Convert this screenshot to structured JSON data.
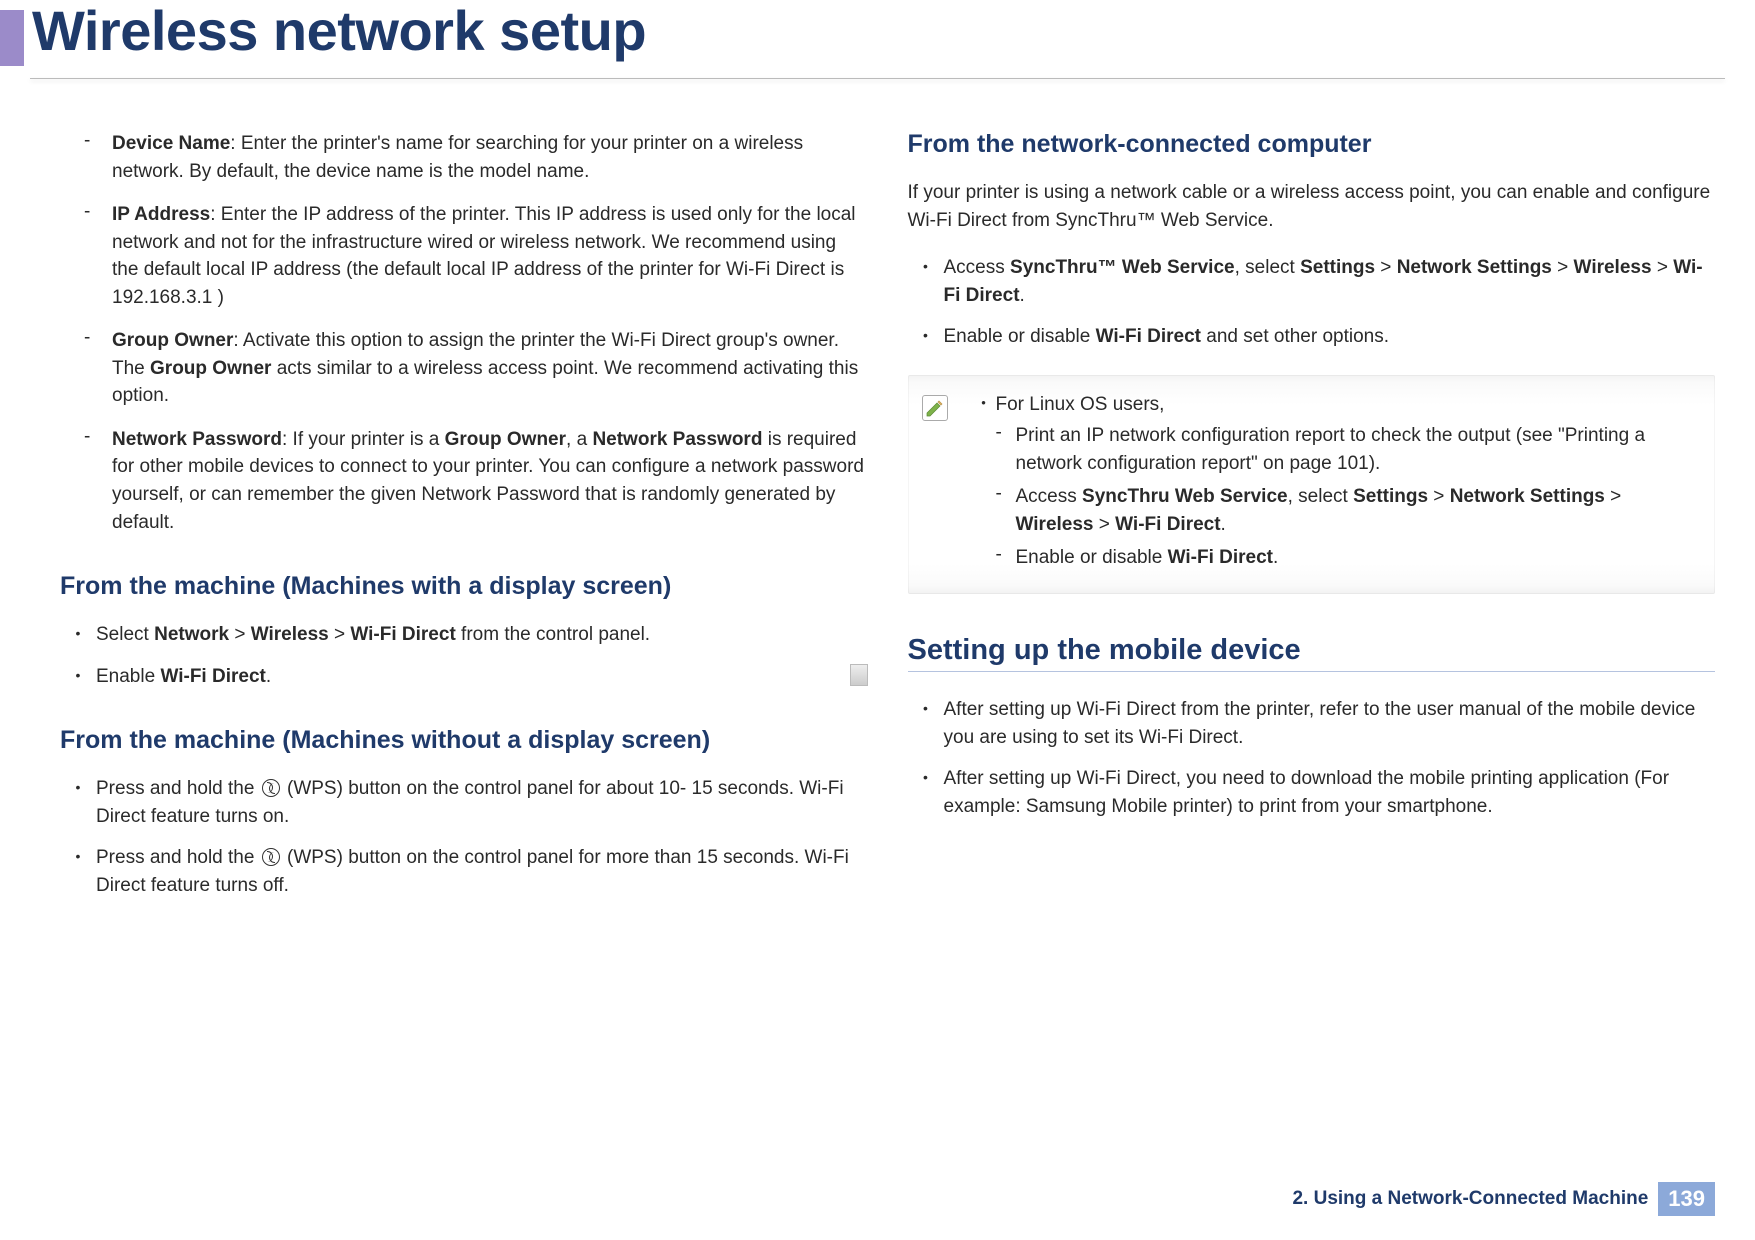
{
  "header": {
    "title": "Wireless network setup"
  },
  "col1": {
    "dash": {
      "device_name_label": "Device Name",
      "device_name_text": ": Enter the printer's name for searching for your printer on a wireless network. By default, the device name is the model name.",
      "ip_label": "IP Address",
      "ip_text": ": Enter the IP address of the printer. This IP address is used only for the local network and not for the infrastructure wired or wireless network. We recommend using the default local IP address (the default local IP address of the printer for Wi-Fi Direct is 192.168.3.1 )",
      "group_owner_label": "Group Owner",
      "group_owner_text_a": ": Activate this option to assign the printer the Wi-Fi Direct group's owner. The ",
      "group_owner_bold_mid": "Group Owner",
      "group_owner_text_b": " acts similar to a wireless access point. We recommend activating this option.",
      "np_label": "Network Password",
      "np_text_a": ": If your printer is a ",
      "np_bold1": "Group Owner",
      "np_text_b": ", a ",
      "np_bold2": "Network Password",
      "np_text_c": " is required for other mobile devices to connect to your printer. You can configure a network password yourself, or can remember the given Network Password that is randomly generated by default."
    },
    "sec_display": {
      "title": "From the machine (Machines with a display screen)",
      "b1_a": "Select ",
      "b1_net": "Network",
      "b1_gt1": " > ",
      "b1_wl": "Wireless",
      "b1_gt2": " > ",
      "b1_wfd": "Wi-Fi Direct",
      "b1_b": " from the control panel.",
      "b2_a": "Enable ",
      "b2_wfd": "Wi-Fi Direct",
      "b2_b": "."
    },
    "sec_nodisplay": {
      "title": "From the machine (Machines without a display screen)",
      "b1_a": "Press and hold the ",
      "b1_b": " (WPS) button on the control panel for about 10- 15 seconds. Wi-Fi Direct feature turns on.",
      "b2_a": "Press and hold the ",
      "b2_b": " (WPS) button on the control panel for more than 15 seconds. Wi-Fi Direct feature turns off."
    }
  },
  "col2": {
    "sec_net": {
      "title": "From the network-connected computer",
      "intro": "If your printer is using a network cable or a wireless access point, you can enable and configure Wi-Fi Direct from SyncThru™ Web Service.",
      "b1_a": "Access ",
      "b1_sws": "SyncThru™ Web Service",
      "b1_b": ", select ",
      "b1_set": "Settings",
      "b1_gt1": " > ",
      "b1_ns": "Network Settings",
      "b1_gt2": " > ",
      "b1_wl": "Wireless",
      "b1_gt3": " > ",
      "b1_wfd": "Wi-Fi Direct",
      "b1_c": ".",
      "b2_a": "Enable or disable ",
      "b2_wfd": "Wi-Fi Direct",
      "b2_b": " and set other options."
    },
    "note": {
      "l1": "For Linux OS users,",
      "d1": "Print an IP network configuration report to check the output (see \"Printing a network configuration report\" on page 101).",
      "d2_a": "Access ",
      "d2_sws": "SyncThru Web Service",
      "d2_b": ", select ",
      "d2_set": "Settings",
      "d2_gt1": " > ",
      "d2_ns": "Network Settings",
      "d2_gt2": " > ",
      "d2_wl": "Wireless",
      "d2_gt3": " > ",
      "d2_wfd": "Wi-Fi Direct",
      "d2_c": ".",
      "d3_a": "Enable or disable ",
      "d3_wfd": "Wi-Fi Direct",
      "d3_b": "."
    },
    "sec_mobile": {
      "title": "Setting up the mobile device",
      "b1": "After setting up Wi-Fi Direct from the printer, refer to the user manual of the mobile device you are using to set its Wi-Fi Direct.",
      "b2": "After setting up Wi-Fi Direct, you need to download the mobile printing application (For example: Samsung Mobile printer) to print from your smartphone."
    }
  },
  "footer": {
    "chapter": "2.  Using a Network-Connected Machine",
    "page": "139"
  }
}
